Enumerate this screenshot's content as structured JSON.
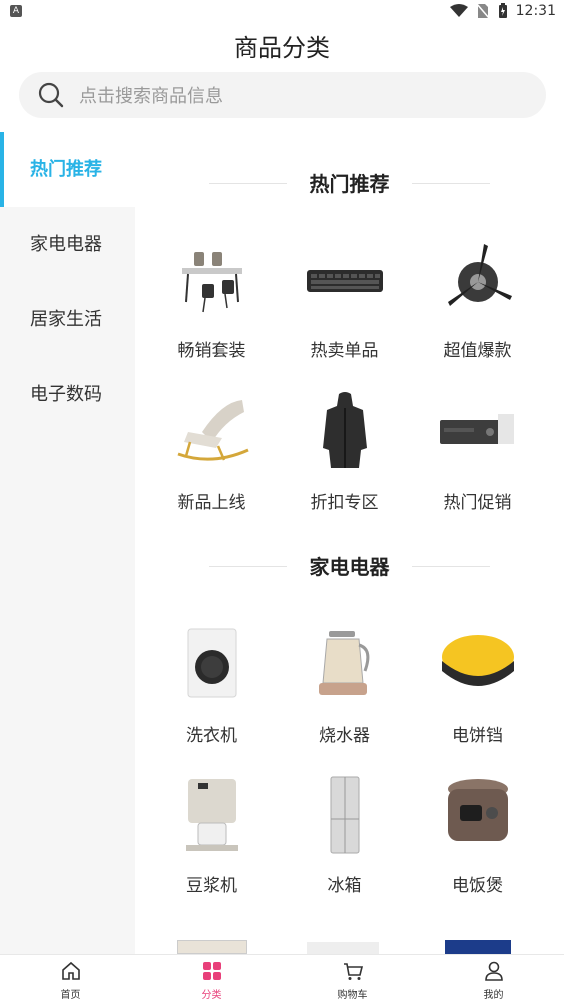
{
  "status_bar": {
    "app_badge": "A",
    "time": "12:31"
  },
  "header": {
    "title": "商品分类"
  },
  "search": {
    "placeholder": "点击搜索商品信息"
  },
  "sidebar": {
    "items": [
      {
        "label": "热门推荐",
        "active": true
      },
      {
        "label": "家电电器",
        "active": false
      },
      {
        "label": "居家生活",
        "active": false
      },
      {
        "label": "电子数码",
        "active": false
      }
    ]
  },
  "sections": [
    {
      "title": "热门推荐",
      "items": [
        {
          "label": "畅销套装",
          "icon": "dining-set"
        },
        {
          "label": "热卖单品",
          "icon": "keyboard"
        },
        {
          "label": "超值爆款",
          "icon": "car-fan"
        },
        {
          "label": "新品上线",
          "icon": "rocking-chair"
        },
        {
          "label": "折扣专区",
          "icon": "jacket"
        },
        {
          "label": "热门促销",
          "icon": "projector"
        }
      ]
    },
    {
      "title": "家电电器",
      "items": [
        {
          "label": "洗衣机",
          "icon": "washing-machine"
        },
        {
          "label": "烧水器",
          "icon": "kettle"
        },
        {
          "label": "电饼铛",
          "icon": "pancake-maker"
        },
        {
          "label": "豆浆机",
          "icon": "soymilk-maker"
        },
        {
          "label": "冰箱",
          "icon": "fridge"
        },
        {
          "label": "电饭煲",
          "icon": "rice-cooker"
        }
      ]
    }
  ],
  "tabbar": {
    "items": [
      {
        "label": "首页",
        "icon": "home-icon"
      },
      {
        "label": "分类",
        "icon": "category-icon",
        "active": true
      },
      {
        "label": "购物车",
        "icon": "cart-icon"
      },
      {
        "label": "我的",
        "icon": "user-icon"
      }
    ]
  },
  "colors": {
    "accent": "#29b3e6",
    "tab_active": "#e8407a"
  }
}
